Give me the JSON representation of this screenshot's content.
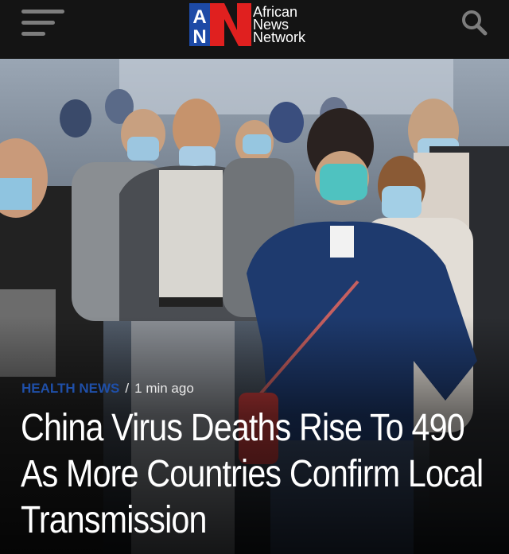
{
  "header": {
    "menu_icon": "hamburger-menu-icon",
    "logo": {
      "mark_letters": [
        "A",
        "N",
        "N"
      ],
      "brand_lines": [
        "African",
        "News",
        "Network"
      ],
      "colors": {
        "blue": "#1d4aa6",
        "red": "#e0201f"
      }
    },
    "search_icon": "search-icon"
  },
  "article": {
    "category": "HEALTH NEWS",
    "separator": "/",
    "time": "1 min ago",
    "headline": "China Virus Deaths Rise To 490 As More Countries Confirm Local Transmission"
  },
  "colors": {
    "topbar": "#141414",
    "category": "#1f4fa8",
    "headline": "#ffffff"
  }
}
